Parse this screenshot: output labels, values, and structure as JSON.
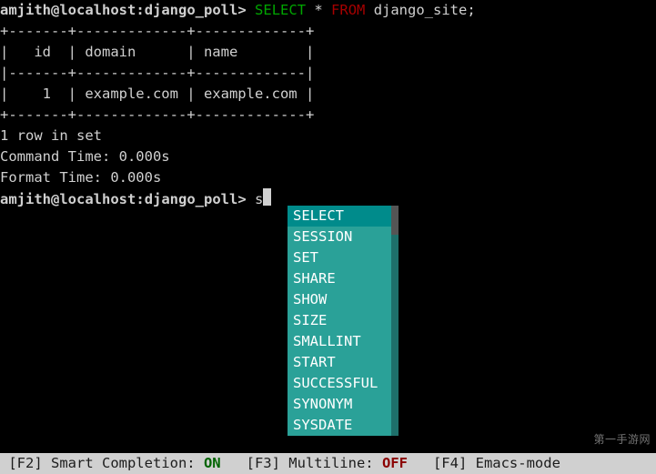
{
  "prompt": {
    "user": "amjith",
    "host": "localhost",
    "db": "django_poll",
    "symbol": ">"
  },
  "query1": {
    "select_kw": "SELECT",
    "star": " * ",
    "from_kw": "FROM",
    "table": " django_site;"
  },
  "table": {
    "border_top": "+-------+-------------+-------------+",
    "header_row": "|   id  | domain      | name        |",
    "border_mid": "|-------+-------------+-------------|",
    "data_row": "|    1  | example.com | example.com |",
    "border_bot": "+-------+-------------+-------------+"
  },
  "result": {
    "rows": "1 row in set",
    "cmd_time": "Command Time: 0.000s",
    "fmt_time": "Format Time: 0.000s"
  },
  "query2": {
    "typed": "s"
  },
  "autocomplete": {
    "items": [
      "SELECT",
      "SESSION",
      "SET",
      "SHARE",
      "SHOW",
      "SIZE",
      "SMALLINT",
      "START",
      "SUCCESSFUL",
      "SYNONYM",
      "SYSDATE"
    ],
    "selected_index": 0
  },
  "statusbar": {
    "f2_label": " [F2] Smart Completion: ",
    "f2_state": "ON",
    "f3_label": "   [F3] Multiline: ",
    "f3_state": "OFF",
    "f4_label": "   [F4] Emacs-mode "
  },
  "watermark": "第一手游网"
}
